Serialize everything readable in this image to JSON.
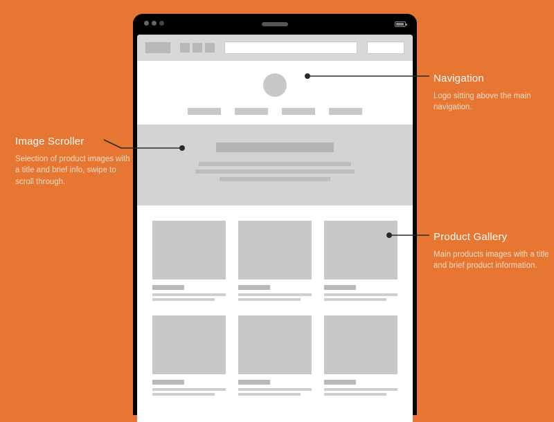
{
  "annotations": {
    "nav": {
      "title": "Navigation",
      "desc": "Logo sitting above the main navigation."
    },
    "scroller": {
      "title": "Image Scroller",
      "desc": "Selection of product images with a title and brief info, swipe to scroll through."
    },
    "gallery": {
      "title": "Product Gallery",
      "desc": "Main products images with a title and brief product information."
    }
  }
}
